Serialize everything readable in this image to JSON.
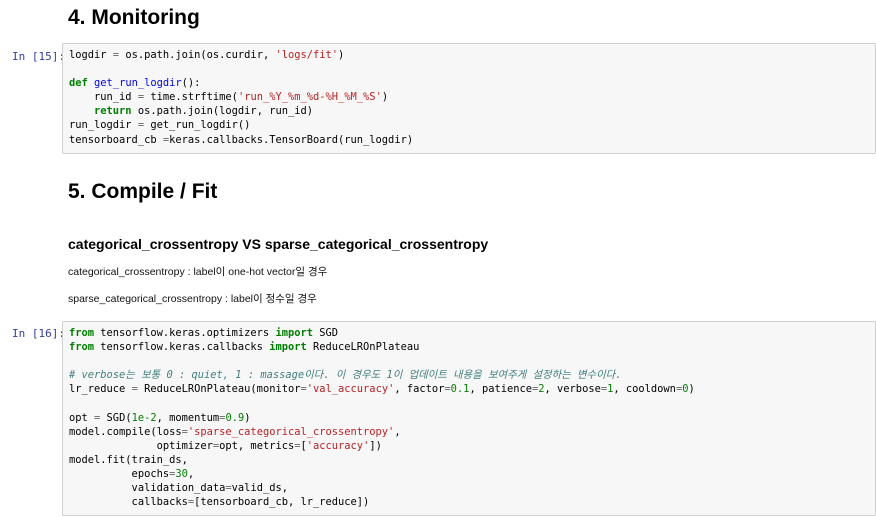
{
  "headings": {
    "monitoring": "4. Monitoring",
    "compile_fit": "5. Compile / Fit",
    "loss_compare": "categorical_crossentropy VS sparse_categorical_crossentropy"
  },
  "notes": [
    "categorical_crossentropy : label이 one-hot vector일 경우",
    "sparse_categorical_crossentropy : label이 정수일 경우"
  ],
  "cells": [
    {
      "prompt": "In [15]:",
      "lines": [
        [
          [
            "logdir ",
            ""
          ],
          [
            "=",
            "op"
          ],
          [
            " os.path.join(os.curdir, ",
            ""
          ],
          [
            "'logs/fit'",
            "str"
          ],
          [
            ")",
            ""
          ]
        ],
        [],
        [
          [
            "def",
            "kw"
          ],
          [
            " ",
            ""
          ],
          [
            "get_run_logdir",
            "fn"
          ],
          [
            "():",
            ""
          ]
        ],
        [
          [
            "    run_id ",
            ""
          ],
          [
            "=",
            "op"
          ],
          [
            " time.strftime(",
            ""
          ],
          [
            "'run_%Y_%m_%d-%H_%M_%S'",
            "str"
          ],
          [
            ")",
            ""
          ]
        ],
        [
          [
            "    ",
            ""
          ],
          [
            "return",
            "kw"
          ],
          [
            " os.path.join(logdir, run_id)",
            ""
          ]
        ],
        [
          [
            "run_logdir ",
            ""
          ],
          [
            "=",
            "op"
          ],
          [
            " get_run_logdir()",
            ""
          ]
        ],
        [
          [
            "tensorboard_cb ",
            ""
          ],
          [
            "=",
            "op"
          ],
          [
            "keras.callbacks.TensorBoard(run_logdir)",
            ""
          ]
        ]
      ]
    },
    {
      "prompt": "In [16]:",
      "lines": [
        [
          [
            "from",
            "kw"
          ],
          [
            " tensorflow.keras.optimizers ",
            ""
          ],
          [
            "import",
            "kw"
          ],
          [
            " SGD",
            ""
          ]
        ],
        [
          [
            "from",
            "kw"
          ],
          [
            " tensorflow.keras.callbacks ",
            ""
          ],
          [
            "import",
            "kw"
          ],
          [
            " ReduceLROnPlateau",
            ""
          ]
        ],
        [],
        [
          [
            "# verbose는 보통 0 : quiet, 1 : massage이다. 이 경우도 1이 업데이트 내용을 보여주게 설정하는 변수이다.",
            "cm"
          ]
        ],
        [
          [
            "lr_reduce ",
            ""
          ],
          [
            "=",
            "op"
          ],
          [
            " ReduceLROnPlateau(monitor",
            ""
          ],
          [
            "=",
            "op"
          ],
          [
            "'val_accuracy'",
            "str"
          ],
          [
            ", factor",
            ""
          ],
          [
            "=",
            "op"
          ],
          [
            "0.1",
            "num"
          ],
          [
            ", patience",
            ""
          ],
          [
            "=",
            "op"
          ],
          [
            "2",
            "num"
          ],
          [
            ", verbose",
            ""
          ],
          [
            "=",
            "op"
          ],
          [
            "1",
            "num"
          ],
          [
            ", cooldown",
            ""
          ],
          [
            "=",
            "op"
          ],
          [
            "0",
            "num"
          ],
          [
            ")",
            ""
          ]
        ],
        [],
        [
          [
            "opt ",
            ""
          ],
          [
            "=",
            "op"
          ],
          [
            " SGD(",
            ""
          ],
          [
            "1e-2",
            "num"
          ],
          [
            ", momentum",
            ""
          ],
          [
            "=",
            "op"
          ],
          [
            "0.9",
            "num"
          ],
          [
            ")",
            ""
          ]
        ],
        [
          [
            "model.compile(loss",
            ""
          ],
          [
            "=",
            "op"
          ],
          [
            "'sparse_categorical_crossentropy'",
            "str"
          ],
          [
            ",",
            ""
          ]
        ],
        [
          [
            "              optimizer",
            ""
          ],
          [
            "=",
            "op"
          ],
          [
            "opt, metrics",
            ""
          ],
          [
            "=",
            "op"
          ],
          [
            "[",
            ""
          ],
          [
            "'accuracy'",
            "str"
          ],
          [
            "])",
            ""
          ]
        ],
        [
          [
            "model.fit(train_ds,",
            ""
          ]
        ],
        [
          [
            "          epochs",
            ""
          ],
          [
            "=",
            "op"
          ],
          [
            "30",
            "num"
          ],
          [
            ",",
            ""
          ]
        ],
        [
          [
            "          validation_data",
            ""
          ],
          [
            "=",
            "op"
          ],
          [
            "valid_ds,",
            ""
          ]
        ],
        [
          [
            "          callbacks",
            ""
          ],
          [
            "=",
            "op"
          ],
          [
            "[tensorboard_cb, lr_reduce])",
            ""
          ]
        ]
      ]
    }
  ]
}
